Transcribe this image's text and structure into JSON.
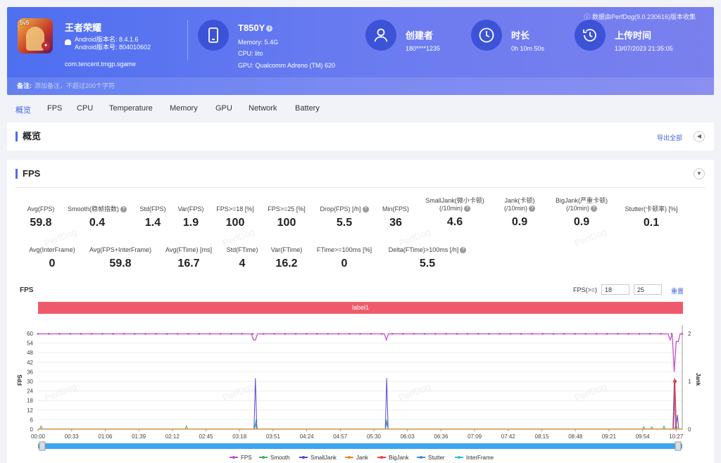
{
  "header": {
    "note": "数据由PerfDog(9.0.230616)版本收集",
    "app": {
      "name": "王者荣耀",
      "icon_badge": "5v5",
      "android_version": "Android版本名: 8.4.1.6",
      "android_code": "Android版本号: 804010602",
      "package": "com.tencent.tmgp.sgame"
    },
    "device": {
      "title": "T850Y",
      "memory": "Memory: 5.4G",
      "cpu": "CPU: lito",
      "gpu": "GPU: Qualcomm Adreno (TM) 620",
      "icon": "phone-icon"
    },
    "creator": {
      "title": "创建者",
      "value": "180****1235",
      "icon": "user-icon"
    },
    "duration": {
      "title": "时长",
      "value": "0h 10m 50s",
      "icon": "clock-icon"
    },
    "upload": {
      "title": "上传时间",
      "value": "13/07/2023 21:35:05",
      "icon": "history-icon"
    },
    "remark_label": "备注:",
    "remark_placeholder": "添加备注，不超过200个字符"
  },
  "tabs": [
    "概览",
    "FPS",
    "CPU",
    "Temperature",
    "Memory",
    "GPU",
    "Network",
    "Battery"
  ],
  "overview": {
    "title": "概览",
    "export": "导出全部"
  },
  "fps_panel": {
    "title": "FPS",
    "stats_row1": [
      {
        "label": "Avg(FPS)",
        "value": "59.8"
      },
      {
        "label": "Smooth(稳帧指数)",
        "value": "0.4"
      },
      {
        "label": "Std(FPS)",
        "value": "1.4"
      },
      {
        "label": "Var(FPS)",
        "value": "1.9"
      },
      {
        "label": "FPS>=18 [%]",
        "value": "100"
      },
      {
        "label": "FPS>=25 [%]",
        "value": "100"
      },
      {
        "label": "Drop(FPS) [/h]",
        "value": "5.5"
      },
      {
        "label": "Min(FPS)",
        "value": "36"
      },
      {
        "label": "SmallJank(微小卡顿)",
        "label2": "(/10min)",
        "value": "4.6"
      },
      {
        "label": "Jank(卡顿)",
        "label2": "(/10min)",
        "value": "0.9"
      },
      {
        "label": "BigJank(严重卡顿)",
        "label2": "(/10min)",
        "value": "0.9"
      },
      {
        "label": "Stutter(卡顿率) [%]",
        "value": "0.1"
      }
    ],
    "stats_row2": [
      {
        "label": "Avg(InterFrame)",
        "value": "0"
      },
      {
        "label": "Avg(FPS+InterFrame)",
        "value": "59.8"
      },
      {
        "label": "Avg(FTime) [ms]",
        "value": "16.7"
      },
      {
        "label": "Std(FTime)",
        "value": "4"
      },
      {
        "label": "Var(FTime)",
        "value": "16.2"
      },
      {
        "label": "FTime>=100ms [%]",
        "value": "0"
      },
      {
        "label": "Delta(FTime)>100ms [/h]",
        "value": "5.5"
      }
    ],
    "chart_title": "FPS",
    "threshold_label": "FPS(>=)",
    "threshold_1": "18",
    "threshold_2": "25",
    "reset": "重置",
    "label_bar": "label1",
    "watermark": "PerfDog"
  },
  "chart_data": {
    "type": "line",
    "title": "FPS",
    "xlabel": "",
    "ylabel": "FPS",
    "y2label": "Jank",
    "ylim": [
      0,
      60
    ],
    "y2lim": [
      0,
      2
    ],
    "yticks": [
      0,
      6,
      12,
      18,
      24,
      30,
      36,
      42,
      48,
      54,
      60
    ],
    "y2ticks": [
      0,
      1,
      2
    ],
    "categories": [
      "00:00",
      "00:33",
      "01:06",
      "01:39",
      "02:12",
      "02:45",
      "03:18",
      "03:51",
      "04:24",
      "04:57",
      "05:30",
      "06:03",
      "06:36",
      "07:09",
      "07:42",
      "08:15",
      "08:48",
      "09:21",
      "09:54",
      "10:27"
    ],
    "series": [
      {
        "name": "FPS",
        "color": "#c24fc6",
        "axis": "left",
        "base": 59.8,
        "dips": [
          [
            3.55,
            56
          ],
          [
            5.7,
            56
          ],
          [
            10.35,
            56
          ],
          [
            10.43,
            36
          ],
          [
            10.47,
            55
          ]
        ]
      },
      {
        "name": "Smooth",
        "color": "#3fae6a",
        "axis": "left",
        "spikes": [
          [
            0.05,
            2
          ],
          [
            2.43,
            2
          ],
          [
            3.57,
            6
          ],
          [
            5.71,
            6
          ],
          [
            9.92,
            1.5
          ],
          [
            10.05,
            1.5
          ],
          [
            10.25,
            2
          ],
          [
            10.45,
            3
          ]
        ]
      },
      {
        "name": "SmallJank",
        "color": "#5548d9",
        "axis": "left",
        "spikes": [
          [
            3.56,
            32
          ],
          [
            5.71,
            32
          ],
          [
            10.42,
            32
          ],
          [
            10.47,
            9
          ]
        ]
      },
      {
        "name": "Jank",
        "color": "#f08a24",
        "axis": "right",
        "spikes": [
          [
            10.43,
            1
          ]
        ]
      },
      {
        "name": "BigJank",
        "color": "#e8403a",
        "axis": "right",
        "spikes": [
          [
            10.43,
            1
          ]
        ]
      },
      {
        "name": "Stutter",
        "color": "#3d8fe0",
        "axis": "left",
        "spikes": [
          [
            3.56,
            4
          ],
          [
            5.71,
            4
          ]
        ]
      },
      {
        "name": "InterFrame",
        "color": "#33c2c8",
        "axis": "left",
        "spikes": []
      }
    ],
    "x_range_minutes": [
      0,
      10.55
    ],
    "legend_position": "bottom"
  }
}
